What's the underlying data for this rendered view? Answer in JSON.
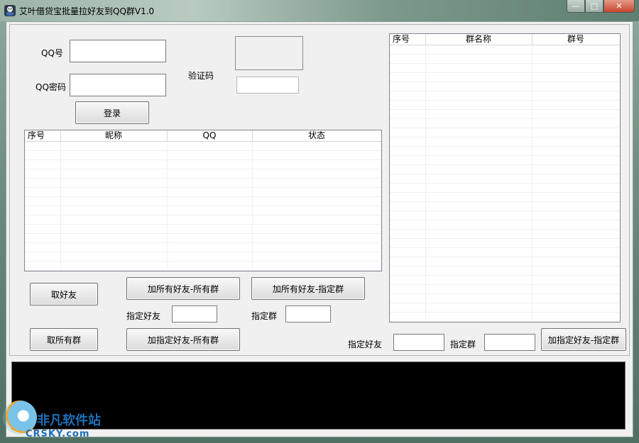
{
  "window": {
    "title": "艾叶借贷宝批量拉好友到QQ群V1.0",
    "min_glyph": "—",
    "max_glyph": "□",
    "close_glyph": "✕"
  },
  "login": {
    "qq_label": "QQ号",
    "qq_value": "",
    "password_label": "QQ密码",
    "password_value": "",
    "captcha_label": "验证码",
    "captcha_value": "",
    "login_button": "登录"
  },
  "friends_table": {
    "columns": [
      "序号",
      "昵称",
      "QQ",
      "状态"
    ]
  },
  "groups_table": {
    "columns": [
      "序号",
      "群名称",
      "群号"
    ]
  },
  "actions": {
    "get_friends": "取好友",
    "get_all_groups": "取所有群",
    "add_all_friends_all_groups": "加所有好友-所有群",
    "add_all_friends_given_group": "加所有好友-指定群",
    "add_given_friend_all_groups": "加指定好友-所有群",
    "add_given_friend_given_group": "加指定好友-指定群",
    "given_friend_label": "指定好友",
    "given_group_label": "指定群",
    "given_friend_value": "",
    "given_group_value": "",
    "bottom_given_friend_label": "指定好友",
    "bottom_given_group_label": "指定群",
    "bottom_given_friend_value": "",
    "bottom_given_group_value": ""
  },
  "watermark": {
    "cn": "非凡软件站",
    "en": "CRSKY.com"
  },
  "colors": {
    "log_background": "#000000",
    "client_background": "#f0f0f0"
  }
}
